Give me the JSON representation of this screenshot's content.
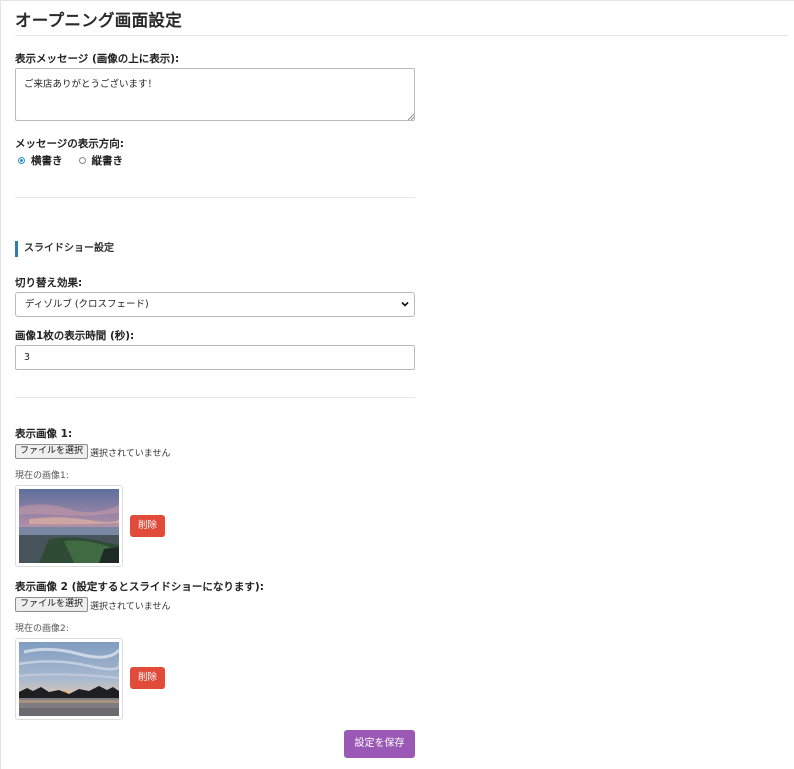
{
  "page": {
    "title": "オープニング画面設定"
  },
  "message": {
    "label": "表示メッセージ (画像の上に表示):",
    "value": "ご来店ありがとうございます！"
  },
  "direction": {
    "label": "メッセージの表示方向:",
    "options": [
      {
        "label": "横書き",
        "selected": true
      },
      {
        "label": "縦書き",
        "selected": false
      }
    ]
  },
  "slideshow": {
    "heading": "スライドショー設定",
    "effect_label": "切り替え効果:",
    "effect_value": "ディゾルブ (クロスフェード)",
    "duration_label": "画像1枚の表示時間 (秒):",
    "duration_value": "3"
  },
  "images": [
    {
      "label": "表示画像 1:",
      "file_button": "ファイルを選択",
      "file_status": "選択されていません",
      "current_label": "現在の画像1:",
      "delete_label": "削除"
    },
    {
      "label": "表示画像 2 (設定するとスライドショーになります):",
      "file_button": "ファイルを選択",
      "file_status": "選択されていません",
      "current_label": "現在の画像2:",
      "delete_label": "削除"
    }
  ],
  "save_label": "設定を保存",
  "colors": {
    "delete": "#e04b3a",
    "save": "#9b59b6",
    "accent": "#2b7fa8"
  }
}
